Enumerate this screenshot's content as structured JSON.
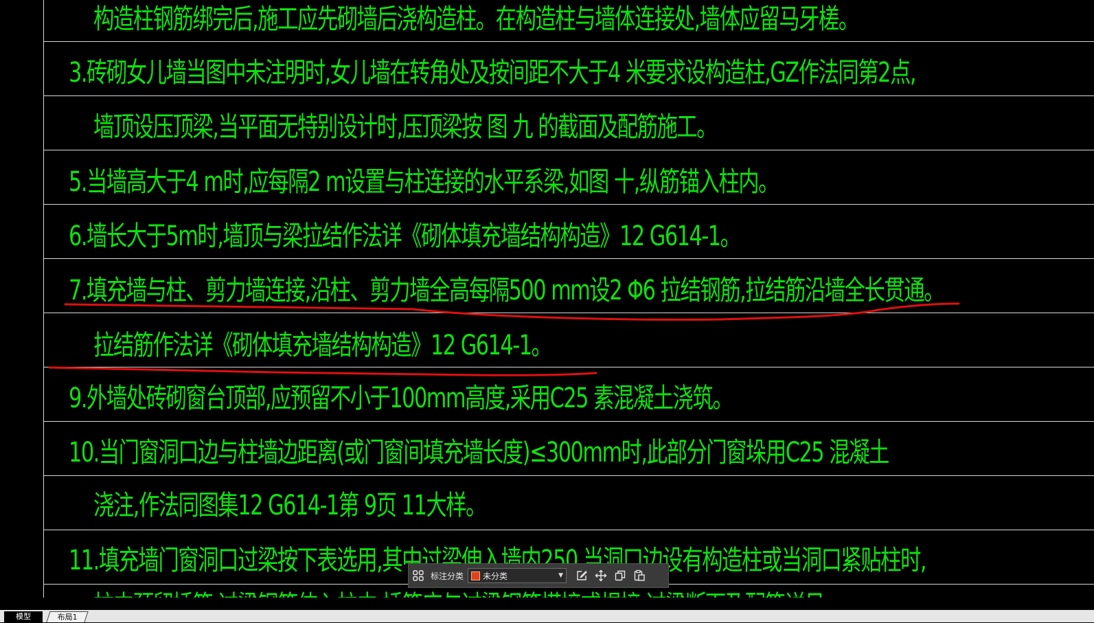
{
  "drawing": {
    "text_color": "#10e010",
    "markup_color": "#e01010",
    "lines": [
      "构造柱钢筋绑完后,施工应先砌墙后浇构造柱。在构造柱与墙体连接处,墙体应留马牙槎。",
      "3.砖砌女儿墙当图中未注明时,女儿墙在转角处及按间距不大于4 米要求设构造柱,GZ作法同第2点,",
      "墙顶设压顶梁,当平面无特别设计时,压顶梁按 图 九 的截面及配筋施工。",
      "5.当墙高大于4 m时,应每隔2 m设置与柱连接的水平系梁,如图 十,纵筋锚入柱内。",
      "6.墙长大于5m时,墙顶与梁拉结作法详《砌体填充墙结构构造》12 G614-1。",
      "7.填充墙与柱、剪力墙连接,沿柱、剪力墙全高每隔500 mm设2 Φ6 拉结钢筋,拉结筋沿墙全长贯通。",
      "拉结筋作法详《砌体填充墙结构构造》12 G614-1。",
      "9.外墙处砖砌窗台顶部,应预留不小于100mm高度,采用C25 素混凝土浇筑。",
      "10.当门窗洞口边与柱墙边距离(或门窗间填充墙长度)≤300mm时,此部分门窗垛用C25 混凝土",
      "浇注,作法同图集12 G614-1第 9页 11大样。",
      "11.填充墙门窗洞口过梁按下表选用,其中过梁伸入墙内250,当洞口边设有构造柱或当洞口紧贴柱时,",
      "柱内预留插筋,过梁钢筋伸入柱内,插筋应与过梁钢筋搭接或焊接,过梁断面及配筋详见"
    ]
  },
  "annotation_toolbar": {
    "label": "标注分类",
    "selected_category": "未分类",
    "category_color": "#e0401a",
    "icons": [
      "grid-icon",
      "edit-icon",
      "move-icon",
      "copy-icon",
      "paste-icon"
    ]
  },
  "tabs": [
    {
      "label": "模型",
      "active": true
    },
    {
      "label": "布局1",
      "active": false
    }
  ]
}
